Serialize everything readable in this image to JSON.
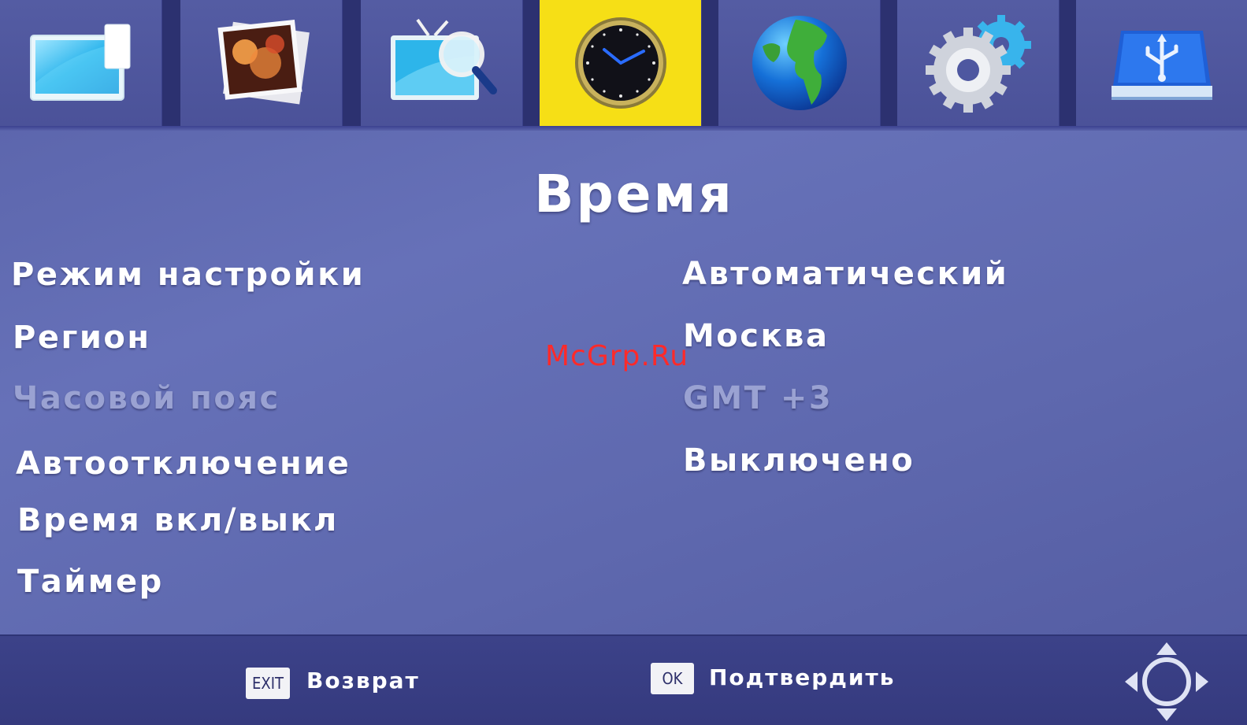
{
  "topbar": {
    "icons": [
      "picture-icon",
      "photos-icon",
      "tv-search-icon",
      "clock-icon",
      "globe-icon",
      "gears-icon",
      "usb-icon"
    ],
    "active_index": 3,
    "active_color": "#f6df16"
  },
  "page": {
    "title": "Время"
  },
  "rows": [
    {
      "label": "Режим настройки",
      "value": "Автоматический",
      "enabled": true
    },
    {
      "label": "Регион",
      "value": "Москва",
      "enabled": true
    },
    {
      "label": "Часовой пояс",
      "value": "GMT +3",
      "enabled": false
    },
    {
      "label": "Автоотключение",
      "value": "Выключено",
      "enabled": true
    },
    {
      "label": "Время вкл/выкл",
      "value": "",
      "enabled": true
    },
    {
      "label": "Таймер",
      "value": "",
      "enabled": true
    }
  ],
  "watermark": "McGrp.Ru",
  "footer": {
    "exit_key": "EXIT",
    "exit_label": "Возврат",
    "ok_key": "OK",
    "ok_label": "Подтвердить",
    "nav_icon": "dpad-icon"
  },
  "colors": {
    "background": "#5e68ae",
    "text": "#ffffff",
    "disabled_text": "#9aa2d2",
    "watermark": "#ff2a2a"
  }
}
